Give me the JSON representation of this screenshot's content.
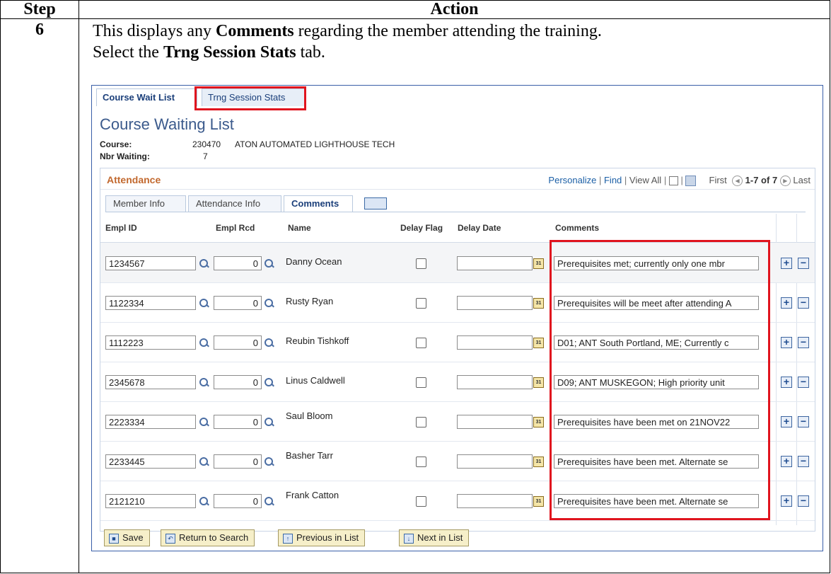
{
  "doc": {
    "col_step": "Step",
    "col_action": "Action",
    "step_number": "6",
    "instr_line1_a": "This displays any ",
    "instr_line1_b": "Comments",
    "instr_line1_c": " regarding the member attending the training.",
    "instr_line2_a": "Select the ",
    "instr_line2_b": "Trng Session Stats",
    "instr_line2_c": " tab."
  },
  "top_tabs": [
    "Course Wait List",
    "Trng Session Stats"
  ],
  "page_title": "Course Waiting List",
  "course": {
    "label": "Course:",
    "code": "230470",
    "name": "ATON AUTOMATED LIGHTHOUSE TECH"
  },
  "waiting": {
    "label": "Nbr Waiting:",
    "value": "7"
  },
  "grid": {
    "title": "Attendance",
    "nav": {
      "personalize": "Personalize",
      "find": "Find",
      "view_all": "View All",
      "first": "First",
      "range": "1-7 of 7",
      "last": "Last"
    },
    "subtabs": [
      "Member Info",
      "Attendance Info",
      "Comments"
    ],
    "columns": [
      "Empl ID",
      "Empl Rcd",
      "Name",
      "Delay Flag",
      "Delay Date",
      "Comments"
    ],
    "rows": [
      {
        "empl_id": "1234567",
        "rcd": "0",
        "name": "Danny Ocean",
        "comment": "Prerequisites met; currently only one mbr"
      },
      {
        "empl_id": "1122334",
        "rcd": "0",
        "name": "Rusty Ryan",
        "comment": "Prerequisites will be meet after attending A"
      },
      {
        "empl_id": "1112223",
        "rcd": "0",
        "name": "Reubin Tishkoff",
        "comment": "D01; ANT South Portland, ME; Currently c"
      },
      {
        "empl_id": "2345678",
        "rcd": "0",
        "name": "Linus Caldwell",
        "comment": "D09; ANT MUSKEGON; High priority unit"
      },
      {
        "empl_id": "2223334",
        "rcd": "0",
        "name": "Saul Bloom",
        "comment": "Prerequisites have been met on 21NOV22"
      },
      {
        "empl_id": "2233445",
        "rcd": "0",
        "name": "Basher Tarr",
        "comment": "Prerequisites have been met. Alternate se"
      },
      {
        "empl_id": "2121210",
        "rcd": "0",
        "name": "Frank Catton",
        "comment": "Prerequisites have been met. Alternate se"
      }
    ]
  },
  "buttons": [
    "Save",
    "Return to Search",
    "Previous in List",
    "Next in List"
  ],
  "colors": {
    "highlight": "#e0141e",
    "grid_title": "#c2692f",
    "link": "#1b5fa6"
  }
}
